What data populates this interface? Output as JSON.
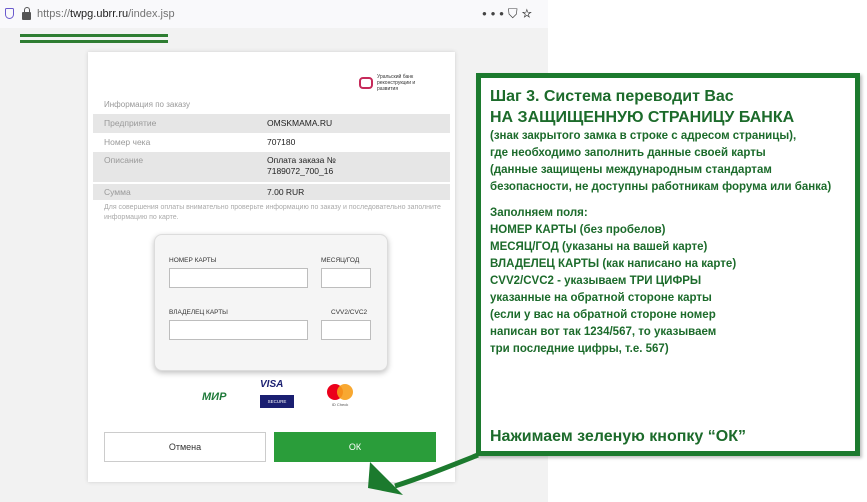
{
  "browser": {
    "url_prefix": "https://",
    "url_host": "twpg.ubrr.ru",
    "url_path": "/index.jsp",
    "icons": [
      "menu-dots-icon",
      "pocket-icon",
      "star-icon"
    ]
  },
  "bank": {
    "logo_text": "Уральский банк реконструкции и развития",
    "section_title": "Информация по заказу",
    "order": [
      {
        "label": "Предприятие",
        "value": "OMSKMAMA.RU"
      },
      {
        "label": "Номер чека",
        "value": "707180"
      },
      {
        "label": "Описание",
        "value": "Оплата заказа № 7189072_700_16"
      },
      {
        "label": "Сумма",
        "value": "7.00 RUR"
      }
    ],
    "note": "Для совершения оплаты внимательно проверьте информацию по заказу и последовательно заполните информацию по карте.",
    "form": {
      "card_number_label": "НОМЕР КАРТЫ",
      "expiry_label": "МЕСЯЦ/ГОД",
      "holder_label": "ВЛАДЕЛЕЦ КАРТЫ",
      "cvv_label": "CVV2/CVC2"
    },
    "payment_logos": {
      "mir": "МИР",
      "visa": "VISA",
      "visa_sub": "SECURE",
      "mc_sub": "ID Check"
    },
    "cancel_label": "Отмена",
    "ok_label": "ОК"
  },
  "callout": {
    "title_line1": "Шаг 3. Система переводит Вас",
    "title_line2": "НА ЗАЩИЩЕННУЮ СТРАНИЦУ БАНКА",
    "desc_lines": [
      "(знак закрытого замка в строке с адресом страницы),",
      "где необходимо заполнить данные своей карты",
      "(данные защищены международным стандартам",
      "безопасности, не доступны работникам форума или банка)"
    ],
    "fill_lines": [
      "Заполняем поля:",
      "НОМЕР КАРТЫ (без пробелов)",
      "МЕСЯЦ/ГОД (указаны на вашей карте)",
      "ВЛАДЕЛЕЦ КАРТЫ (как написано на карте)",
      "CVV2/CVC2 - указываем ТРИ ЦИФРЫ",
      "указанные на обратной стороне карты",
      "(если у вас на обратной стороне номер",
      "написан вот так 1234/567, то указываем",
      "три последние цифры, т.е. 567)"
    ],
    "final": "Нажимаем зеленую кнопку “ОК”"
  },
  "colors": {
    "accent_green": "#1c7a2e",
    "ok_button": "#2a9d3a",
    "bank_brand": "#c62a5a"
  }
}
